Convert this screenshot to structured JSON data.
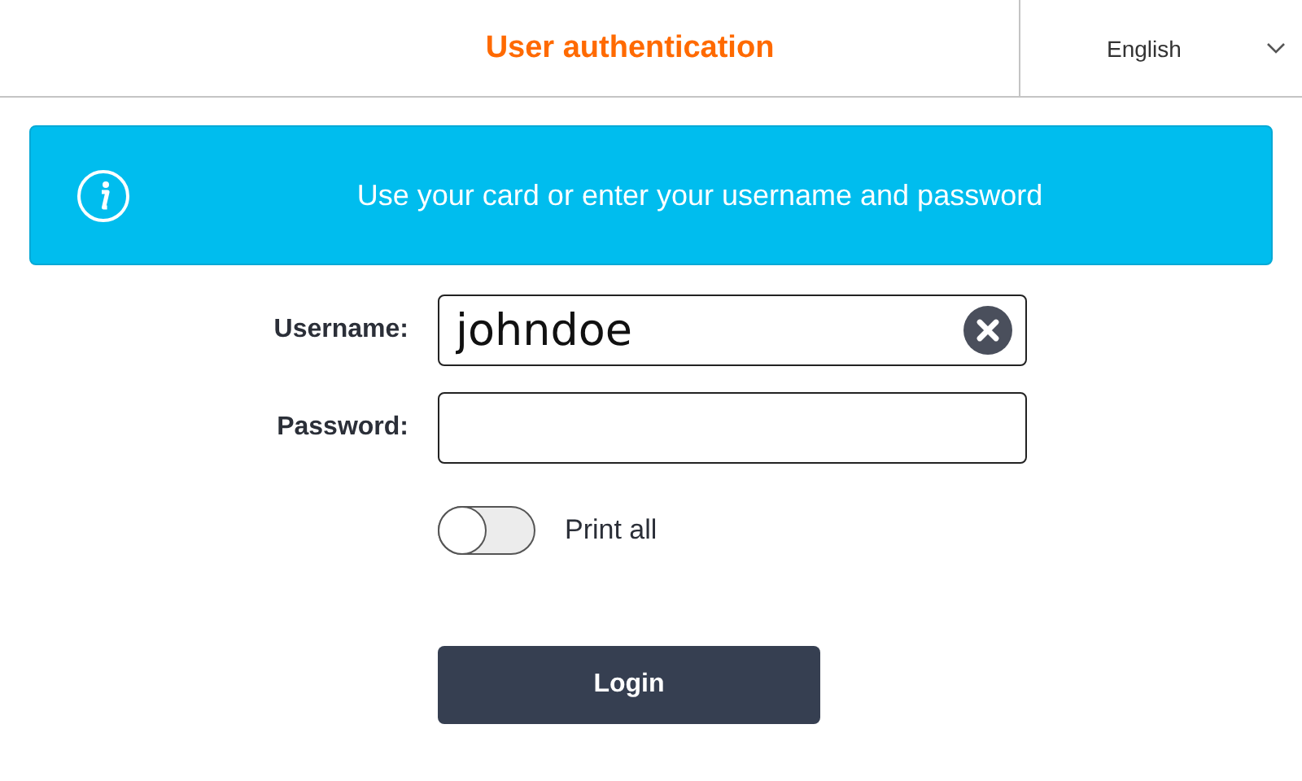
{
  "header": {
    "title": "User authentication",
    "language": "English"
  },
  "banner": {
    "message": "Use your card or enter your username and password"
  },
  "fields": [
    {
      "kind": "text",
      "label": "Username:",
      "value": "johndoe"
    },
    {
      "kind": "password",
      "label": "Password:"
    }
  ],
  "toggle": {
    "label": "Print all",
    "on": false
  },
  "button": {
    "label": "Login"
  }
}
